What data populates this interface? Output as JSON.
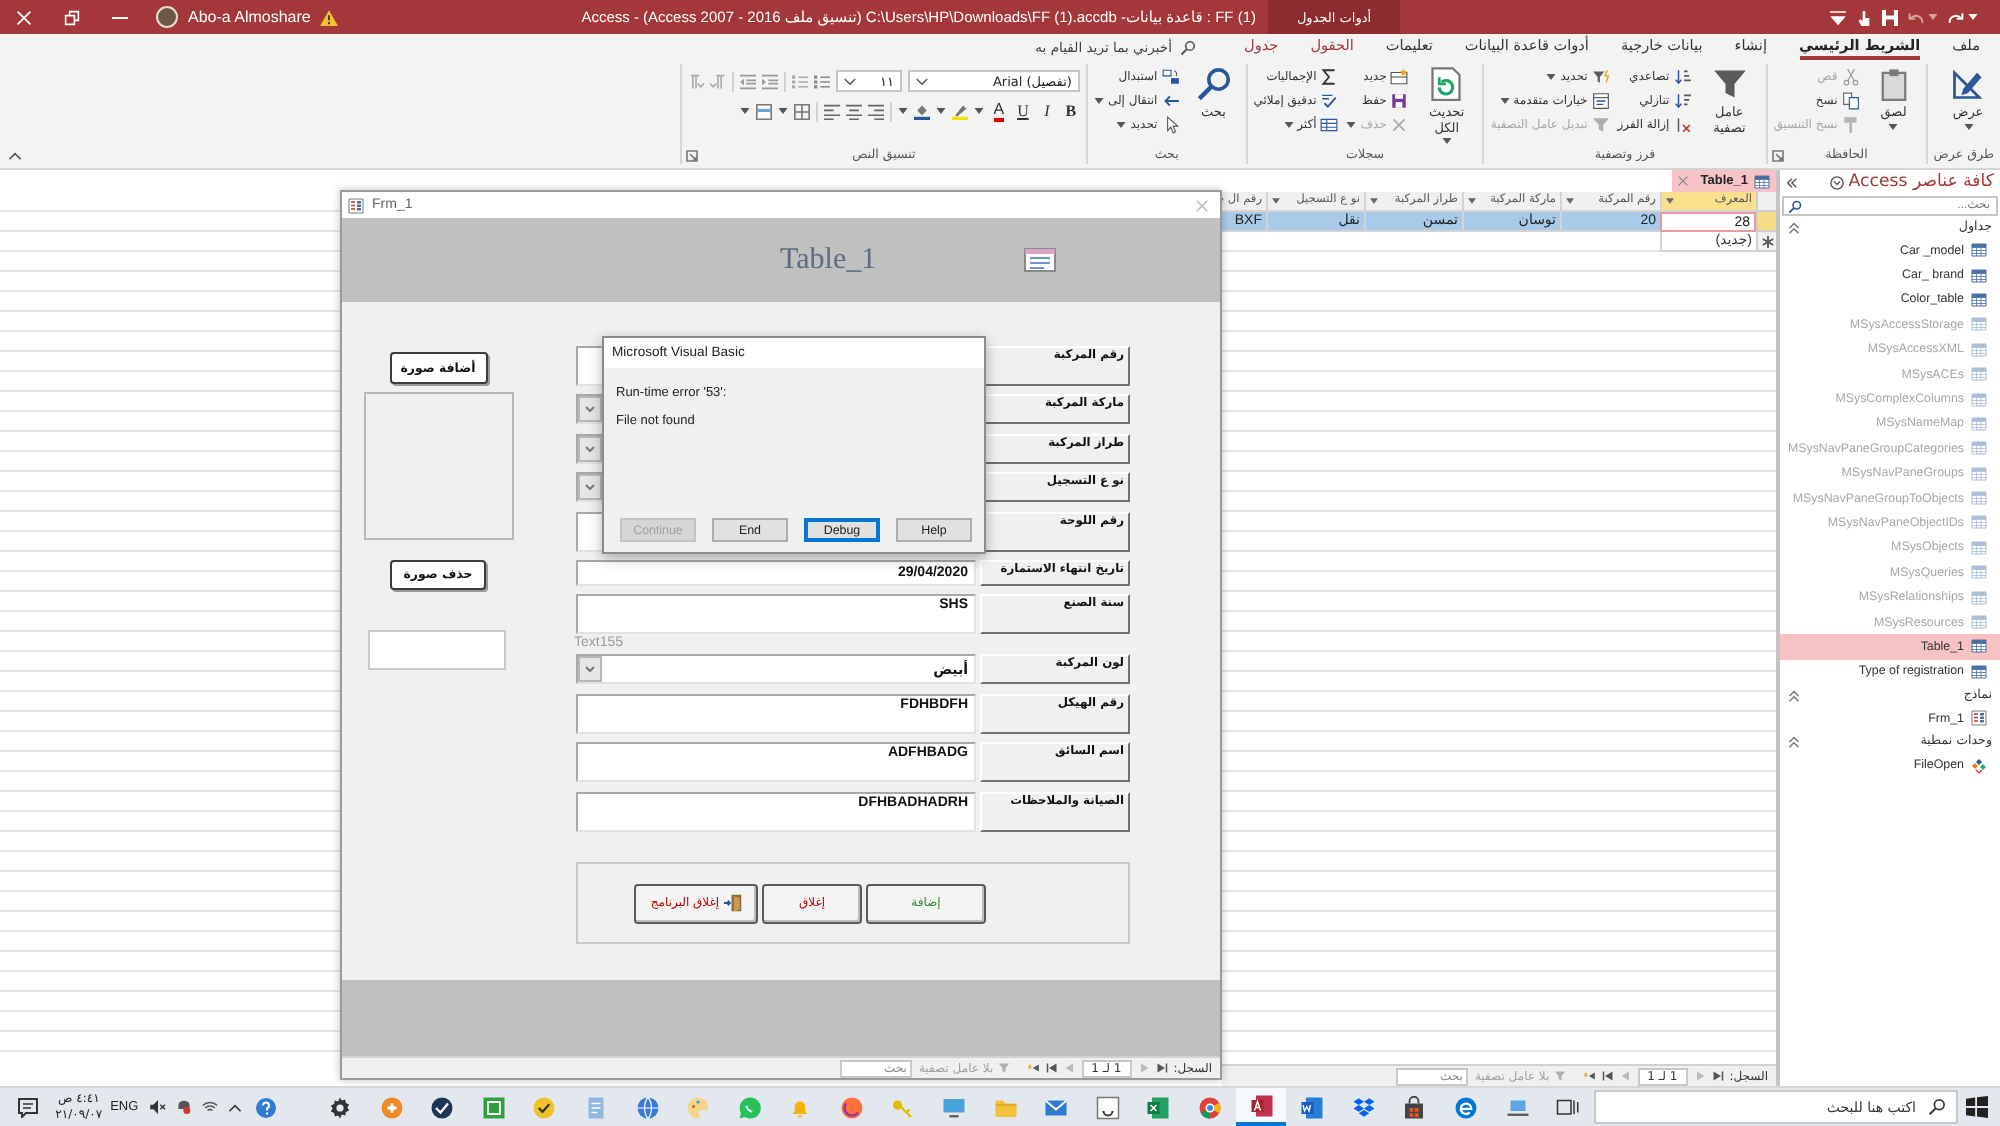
{
  "title_bar": {
    "account": "Abo-a Almoshare",
    "title": "FF (1) : قاعدة بيانات- C:\\Users\\HP\\Downloads\\FF (1).accdb (تنسيق ملف Access 2007 - 2016) - Access",
    "context_label": "أدوات الجدول"
  },
  "ribbon_tabs": [
    {
      "label": "ملف",
      "kind": "normal",
      "selected": false
    },
    {
      "label": "الشريط الرئيسي",
      "kind": "normal",
      "selected": true
    },
    {
      "label": "إنشاء",
      "kind": "normal",
      "selected": false
    },
    {
      "label": "بيانات خارجية",
      "kind": "normal",
      "selected": false
    },
    {
      "label": "أدوات قاعدة البيانات",
      "kind": "normal",
      "selected": false
    },
    {
      "label": "تعليمات",
      "kind": "normal",
      "selected": false
    },
    {
      "label": "الحقول",
      "kind": "contextual",
      "selected": false
    },
    {
      "label": "جدول",
      "kind": "contextual",
      "selected": false
    }
  ],
  "tell_me": {
    "placeholder": "أخبرني بما تريد القيام به"
  },
  "ribbon_groups": [
    {
      "label": "طرق عرض",
      "kind": "buttons",
      "launcher": false,
      "large": [
        {
          "label": "عرض",
          "kind": "view",
          "caret": true,
          "disabled": false
        }
      ]
    },
    {
      "label": "الحافظة",
      "kind": "buttons",
      "launcher": true,
      "large": [
        {
          "label": "لصق",
          "kind": "paste",
          "caret": true,
          "disabled": false
        }
      ],
      "columns": [
        [
          {
            "label": "قص",
            "kind": "scissors",
            "caret": false,
            "disabled": true
          },
          {
            "label": "نسخ",
            "kind": "copy",
            "caret": false,
            "disabled": false
          },
          {
            "label": "نسخ التنسيق",
            "kind": "brush",
            "caret": false,
            "disabled": true
          }
        ]
      ]
    },
    {
      "label": "فرز وتصفية",
      "kind": "buttons",
      "launcher": false,
      "large": [
        {
          "label": "عامل تصفية",
          "kind": "funnel",
          "caret": false,
          "disabled": false
        }
      ],
      "columns": [
        [
          {
            "label": "تصاعدي",
            "kind": "ascending",
            "caret": false,
            "disabled": false
          },
          {
            "label": "تنازلي",
            "kind": "descending",
            "caret": false,
            "disabled": false
          },
          {
            "label": "إزالة الفرز",
            "kind": "clearsort",
            "caret": false,
            "disabled": false
          }
        ],
        [
          {
            "label": "تحديد",
            "kind": "selection",
            "caret": true,
            "disabled": false
          },
          {
            "label": "خيارات متقدمة",
            "kind": "advanced",
            "caret": true,
            "disabled": false
          },
          {
            "label": "تبديل عامل التصفية",
            "kind": "toggle",
            "caret": false,
            "disabled": true
          }
        ]
      ]
    },
    {
      "label": "سجلات",
      "kind": "buttons",
      "launcher": false,
      "large": [
        {
          "label": "تحديث الكل",
          "kind": "refresh",
          "caret": true,
          "disabled": false
        }
      ],
      "columns": [
        [
          {
            "label": "جديد",
            "kind": "newrecord",
            "caret": false,
            "disabled": false
          },
          {
            "label": "حفظ",
            "kind": "save",
            "caret": false,
            "disabled": false
          },
          {
            "label": "حذف",
            "kind": "delete",
            "caret": true,
            "disabled": true
          }
        ],
        [
          {
            "label": "الإجماليات",
            "kind": "sigma",
            "caret": false,
            "disabled": false
          },
          {
            "label": "تدقيق إملائي",
            "kind": "spelling",
            "caret": false,
            "disabled": false
          },
          {
            "label": "أكثر",
            "kind": "more",
            "caret": true,
            "disabled": false
          }
        ]
      ]
    },
    {
      "label": "بحث",
      "kind": "buttons",
      "launcher": false,
      "large": [
        {
          "label": "بحث",
          "kind": "search",
          "caret": false,
          "disabled": false
        }
      ],
      "columns": [
        [
          {
            "label": "استبدال",
            "kind": "replace",
            "caret": false,
            "disabled": false
          },
          {
            "label": "انتقال إلى",
            "kind": "goto",
            "caret": true,
            "disabled": false
          },
          {
            "label": "تحديد",
            "kind": "pointer",
            "caret": true,
            "disabled": false
          }
        ]
      ]
    },
    {
      "label": "تنسيق النص",
      "kind": "format",
      "launcher": true,
      "font": "(تفصيل) Arial",
      "size": "١١",
      "style_buttons": [
        "B",
        "I",
        "U"
      ],
      "color_button": "A"
    }
  ],
  "datasheet": {
    "tab": "Table_1",
    "columns": [
      {
        "label": "المعرف",
        "selected": true
      },
      {
        "label": "رقم المركبة",
        "selected": false
      },
      {
        "label": "ماركة المركبة",
        "selected": false
      },
      {
        "label": "طراز المركبة",
        "selected": false
      },
      {
        "label": "نو ع التسجيل",
        "selected": false
      },
      {
        "label": "رقم ال",
        "selected": false
      }
    ],
    "rows": [
      {
        "selected": true,
        "cells": [
          {
            "text": "28",
            "focused": true
          },
          {
            "text": "20",
            "focused": false
          },
          {
            "text": "توسان",
            "focused": false
          },
          {
            "text": "تمسن",
            "focused": false
          },
          {
            "text": "نقل",
            "focused": false
          },
          {
            "text": "BXF",
            "focused": false
          }
        ]
      }
    ],
    "new_row": "(جديد)",
    "record_nav": {
      "label": "السجل:",
      "position": "1 لـ 1",
      "filter": "بلا عامل تصفية",
      "search": {
        "placeholder": "بحث"
      }
    }
  },
  "form": {
    "title": "Frm_1",
    "heading": "Table_1",
    "add_image_button": "أضافة صورة",
    "delete_image_button": "حذف صورة",
    "fields": [
      {
        "label": "رقم المركبة",
        "kind": "memo"
      },
      {
        "label": "ماركة المركبة",
        "kind": "combo"
      },
      {
        "label": "طراز المركبة",
        "kind": "combo"
      },
      {
        "label": "نو ع التسجيل",
        "kind": "combo"
      },
      {
        "label": "رقم اللوحة",
        "kind": "memo"
      },
      {
        "label": "تاريخ انتهاء الاستمارة",
        "kind": "text",
        "value": "29/04/2020"
      },
      {
        "label": "سنة الصنع",
        "kind": "memo",
        "value": "SHS"
      },
      {
        "label": "لون المركبة",
        "kind": "combo",
        "value": "أبيض",
        "caption": "Text155"
      },
      {
        "label": "رقم الهيكل",
        "kind": "memo",
        "value": "FDHBDFH"
      },
      {
        "label": "اسم السائق",
        "kind": "memo",
        "value": "ADFHBADG"
      },
      {
        "label": "الصيانة والملاحظات",
        "kind": "memo",
        "value": "DFHBADHADRH"
      }
    ],
    "actions": [
      {
        "label": "إضافة",
        "kind": "add"
      },
      {
        "label": "إغلاق",
        "kind": "close"
      },
      {
        "label": "إغلاق البرنامج",
        "kind": "exit"
      }
    ],
    "record_nav": {
      "label": "السجل:",
      "position": "1 لـ 1",
      "filter": "بلا عامل تصفية",
      "search": {
        "placeholder": "بحث"
      }
    }
  },
  "dialog": {
    "title": "Microsoft Visual Basic",
    "message": [
      "Run-time error '53':",
      "File not found"
    ],
    "buttons": [
      {
        "label": "Help",
        "disabled": false,
        "focused": false
      },
      {
        "label": "Debug",
        "disabled": false,
        "focused": true
      },
      {
        "label": "End",
        "disabled": false,
        "focused": false
      },
      {
        "label": "Continue",
        "disabled": true,
        "focused": false
      }
    ]
  },
  "nav_pane": {
    "title": "كافة عناصر Access",
    "search": {
      "placeholder": "بحث..."
    },
    "groups": [
      {
        "label": "جداول",
        "expanded": true,
        "items": [
          {
            "label": "Car _model",
            "kind": "table",
            "hidden": false,
            "selected": false
          },
          {
            "label": "Car_ brand",
            "kind": "table",
            "hidden": false,
            "selected": false
          },
          {
            "label": "Color_table",
            "kind": "table",
            "hidden": false,
            "selected": false
          },
          {
            "label": "MSysAccessStorage",
            "kind": "table",
            "hidden": true,
            "selected": false
          },
          {
            "label": "MSysAccessXML",
            "kind": "table",
            "hidden": true,
            "selected": false
          },
          {
            "label": "MSysACEs",
            "kind": "table",
            "hidden": true,
            "selected": false
          },
          {
            "label": "MSysComplexColumns",
            "kind": "table",
            "hidden": true,
            "selected": false
          },
          {
            "label": "MSysNameMap",
            "kind": "table",
            "hidden": true,
            "selected": false
          },
          {
            "label": "MSysNavPaneGroupCategories",
            "kind": "table",
            "hidden": true,
            "selected": false
          },
          {
            "label": "MSysNavPaneGroups",
            "kind": "table",
            "hidden": true,
            "selected": false
          },
          {
            "label": "MSysNavPaneGroupToObjects",
            "kind": "table",
            "hidden": true,
            "selected": false
          },
          {
            "label": "MSysNavPaneObjectIDs",
            "kind": "table",
            "hidden": true,
            "selected": false
          },
          {
            "label": "MSysObjects",
            "kind": "table",
            "hidden": true,
            "selected": false
          },
          {
            "label": "MSysQueries",
            "kind": "table",
            "hidden": true,
            "selected": false
          },
          {
            "label": "MSysRelationships",
            "kind": "table",
            "hidden": true,
            "selected": false
          },
          {
            "label": "MSysResources",
            "kind": "table",
            "hidden": true,
            "selected": false
          },
          {
            "label": "Table_1",
            "kind": "table",
            "hidden": false,
            "selected": true
          },
          {
            "label": "Type of registration",
            "kind": "table",
            "hidden": false,
            "selected": false
          }
        ]
      },
      {
        "label": "نماذج",
        "expanded": true,
        "items": [
          {
            "label": "Frm_1",
            "kind": "form",
            "hidden": false,
            "selected": false
          }
        ]
      },
      {
        "label": "وحدات نمطية",
        "expanded": true,
        "items": [
          {
            "label": "FileOpen",
            "kind": "module",
            "hidden": false,
            "selected": false
          }
        ]
      }
    ]
  },
  "taskbar": {
    "search": {
      "placeholder": "اكتب هنا للبحث"
    },
    "apps": [
      {
        "kind": "taskview",
        "active": false
      },
      {
        "kind": "laptop",
        "active": false
      },
      {
        "kind": "edge",
        "active": false
      },
      {
        "kind": "bag",
        "active": false
      },
      {
        "kind": "box",
        "active": false
      },
      {
        "kind": "document",
        "active": false
      },
      {
        "kind": "database",
        "active": true
      },
      {
        "kind": "chrome",
        "active": false
      },
      {
        "kind": "sheet",
        "active": false
      },
      {
        "kind": "tile",
        "active": false
      },
      {
        "kind": "mail",
        "active": false
      },
      {
        "kind": "folder",
        "active": false
      },
      {
        "kind": "monitor",
        "active": false
      },
      {
        "kind": "key",
        "active": false
      },
      {
        "kind": "fox",
        "active": false
      },
      {
        "kind": "bell",
        "active": false
      },
      {
        "kind": "chat",
        "active": false
      },
      {
        "kind": "palette",
        "active": false
      },
      {
        "kind": "globe",
        "active": false
      },
      {
        "kind": "notepad",
        "active": false
      },
      {
        "kind": "check",
        "active": false
      },
      {
        "kind": "greentile",
        "active": false
      },
      {
        "kind": "disc",
        "active": false
      },
      {
        "kind": "plus",
        "active": false
      },
      {
        "kind": "gear",
        "active": false
      }
    ],
    "language": "ENG",
    "time": "٤:٤١ ص",
    "date": "٢١/٠٩/٠٧"
  }
}
